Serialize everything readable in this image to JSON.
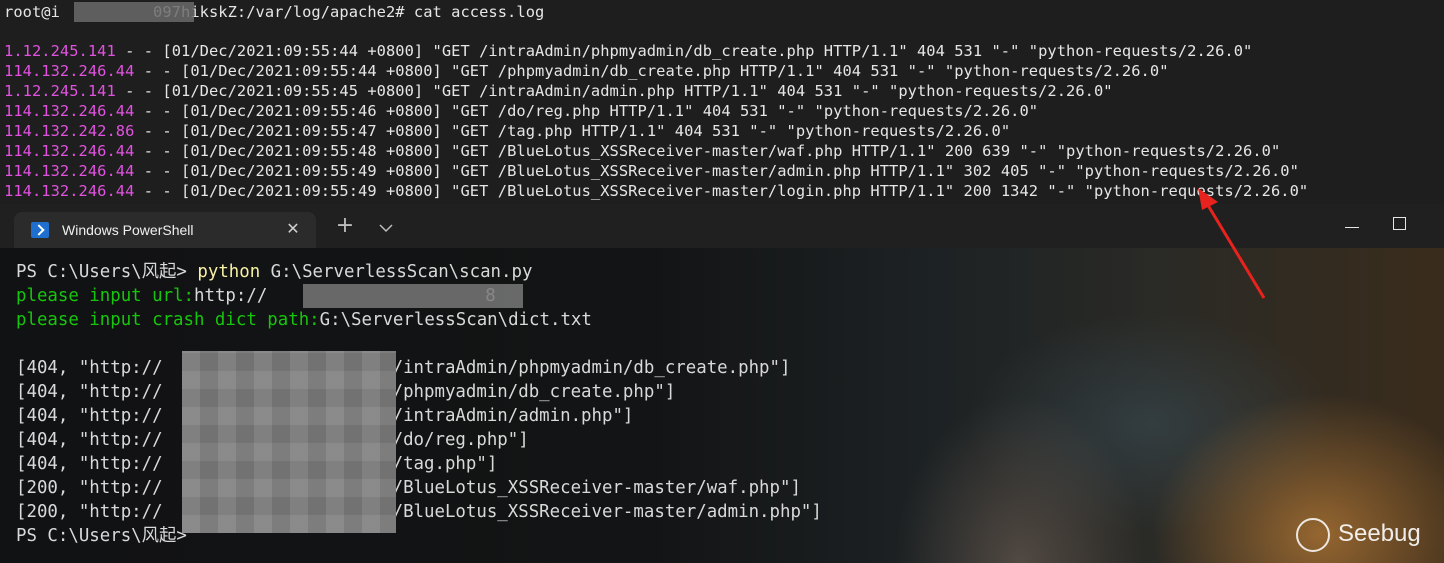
{
  "top_terminal": {
    "prompt_line": "root@i          097hikskZ:/var/log/apache2# cat access.log",
    "log_lines": [
      {
        "ip": "1.12.245.141",
        "rest": " - - [01/Dec/2021:09:55:44 +0800] \"GET /intraAdmin/phpmyadmin/db_create.php HTTP/1.1\" 404 531 \"-\" \"python-requests/2.26.0\""
      },
      {
        "ip": "114.132.246.44",
        "rest": " - - [01/Dec/2021:09:55:44 +0800] \"GET /phpmyadmin/db_create.php HTTP/1.1\" 404 531 \"-\" \"python-requests/2.26.0\""
      },
      {
        "ip": "1.12.245.141",
        "rest": " - - [01/Dec/2021:09:55:45 +0800] \"GET /intraAdmin/admin.php HTTP/1.1\" 404 531 \"-\" \"python-requests/2.26.0\""
      },
      {
        "ip": "114.132.246.44",
        "rest": " - - [01/Dec/2021:09:55:46 +0800] \"GET /do/reg.php HTTP/1.1\" 404 531 \"-\" \"python-requests/2.26.0\""
      },
      {
        "ip": "114.132.242.86",
        "rest": " - - [01/Dec/2021:09:55:47 +0800] \"GET /tag.php HTTP/1.1\" 404 531 \"-\" \"python-requests/2.26.0\""
      },
      {
        "ip": "114.132.246.44",
        "rest": " - - [01/Dec/2021:09:55:48 +0800] \"GET /BlueLotus_XSSReceiver-master/waf.php HTTP/1.1\" 200 639 \"-\" \"python-requests/2.26.0\""
      },
      {
        "ip": "114.132.246.44",
        "rest": " - - [01/Dec/2021:09:55:49 +0800] \"GET /BlueLotus_XSSReceiver-master/admin.php HTTP/1.1\" 302 405 \"-\" \"python-requests/2.26.0\""
      },
      {
        "ip": "114.132.246.44",
        "rest": " - - [01/Dec/2021:09:55:49 +0800] \"GET /BlueLotus_XSSReceiver-master/login.php HTTP/1.1\" 200 1342 \"-\" \"python-requests/2.26.0\""
      }
    ]
  },
  "powershell": {
    "tab_title": "Windows PowerShell",
    "tab_close": "✕",
    "new_tab": "+",
    "prompt": "PS C:\\Users\\风起> ",
    "command": "python",
    "command_arg": " G:\\ServerlessScan\\scan.py",
    "url_label": "please input url:",
    "url_value": "http://",
    "url_tail": "8",
    "dict_label": "please input crash dict path:",
    "dict_value": "G:\\ServerlessScan\\dict.txt",
    "results": [
      {
        "prefix": "[404, \"http://",
        "suffix": "/intraAdmin/phpmyadmin/db_create.php\"]"
      },
      {
        "prefix": "[404, \"http://",
        "suffix": "/phpmyadmin/db_create.php\"]"
      },
      {
        "prefix": "[404, \"http://",
        "suffix": "/intraAdmin/admin.php\"]"
      },
      {
        "prefix": "[404, \"http://",
        "suffix": "/do/reg.php\"]"
      },
      {
        "prefix": "[404, \"http://",
        "suffix": "/tag.php\"]"
      },
      {
        "prefix": "[200, \"http://",
        "suffix": "/BlueLotus_XSSReceiver-master/waf.php\"]"
      },
      {
        "prefix": "[200, \"http://",
        "suffix": "/BlueLotus_XSSReceiver-master/admin.php\"]"
      }
    ],
    "final_prompt": "PS C:\\Users\\风起>"
  },
  "watermark": {
    "text": "Seebug"
  },
  "colors": {
    "ip": "#e152e1",
    "green": "#16c60c",
    "command": "#f9f1a5",
    "arrow": "#e8231d"
  }
}
